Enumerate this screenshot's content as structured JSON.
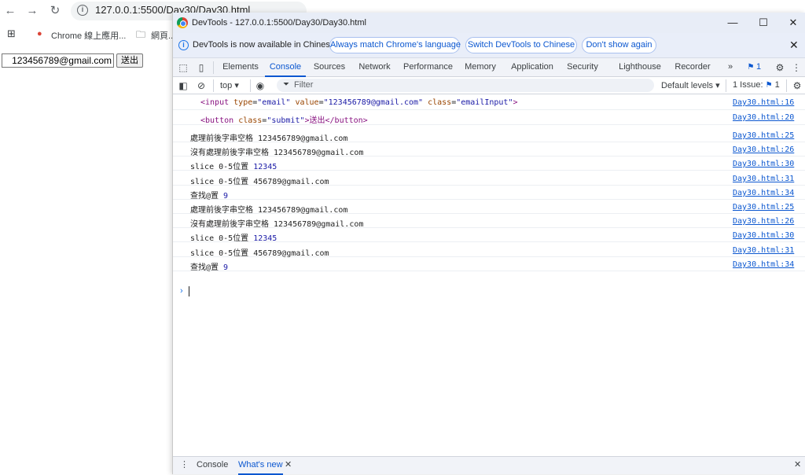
{
  "browser": {
    "url": "127.0.0.1:5500/Day30/Day30.html",
    "bookmarks": [
      {
        "label": "Chrome 線上應用..."
      },
      {
        "label": "網頁..."
      }
    ],
    "page": {
      "email_value": "123456789@gmail.com",
      "submit_label": "送出"
    }
  },
  "devtools": {
    "title": "DevTools - 127.0.0.1:5500/Day30/Day30.html",
    "infobar": {
      "text": "DevTools is now available in Chinese!",
      "btn_match": "Always match Chrome's language",
      "btn_switch": "Switch DevTools to Chinese",
      "btn_dismiss": "Don't show again"
    },
    "tabs": [
      "Elements",
      "Console",
      "Sources",
      "Network",
      "Performance",
      "Memory",
      "Application",
      "Security",
      "Lighthouse",
      "Recorder"
    ],
    "active_tab": "Console",
    "more_tabs": "»",
    "issue_badge_count": "1",
    "toolbar": {
      "context": "top ▾",
      "filter_placeholder": "Filter",
      "levels": "Default levels ▾",
      "issues": "1 Issue:",
      "issues_count": "1"
    },
    "console": {
      "input_line": {
        "tag_open": "<input",
        "attr1": "type",
        "val1": "\"email\"",
        "attr2": "value",
        "val2": "\"123456789@gmail.com\"",
        "attr3": "class",
        "val3": "\"emailInput\"",
        "tag_close": ">"
      },
      "button_line": {
        "tag_open": "<button",
        "attr": "class",
        "val": "\"submit\"",
        "text": ">送出</button>"
      },
      "input_src": "Day30.html:16",
      "button_src": "Day30.html:20",
      "messages": [
        {
          "label": "處理前後字串空格",
          "value": "123456789@gmail.com",
          "src": "Day30.html:25"
        },
        {
          "label": "沒有處理前後字串空格",
          "value": "123456789@gmail.com",
          "src": "Day30.html:26"
        },
        {
          "label": "slice 0-5位置",
          "value": "12345",
          "src": "Day30.html:30"
        },
        {
          "label": "slice 0-5位置",
          "value": "456789@gmail.com",
          "src": "Day30.html:31"
        },
        {
          "label": "查找@置",
          "value": "9",
          "src": "Day30.html:34"
        },
        {
          "label": "處理前後字串空格",
          "value": "123456789@gmail.com",
          "src": "Day30.html:25"
        },
        {
          "label": "沒有處理前後字串空格",
          "value": "123456789@gmail.com",
          "src": "Day30.html:26"
        },
        {
          "label": "slice 0-5位置",
          "value": "12345",
          "src": "Day30.html:30"
        },
        {
          "label": "slice 0-5位置",
          "value": "456789@gmail.com",
          "src": "Day30.html:31"
        },
        {
          "label": "查找@置",
          "value": "9",
          "src": "Day30.html:34"
        }
      ],
      "prompt": "›"
    },
    "drawer": {
      "tabs": [
        "Console",
        "What's new"
      ],
      "active": "What's new"
    }
  }
}
